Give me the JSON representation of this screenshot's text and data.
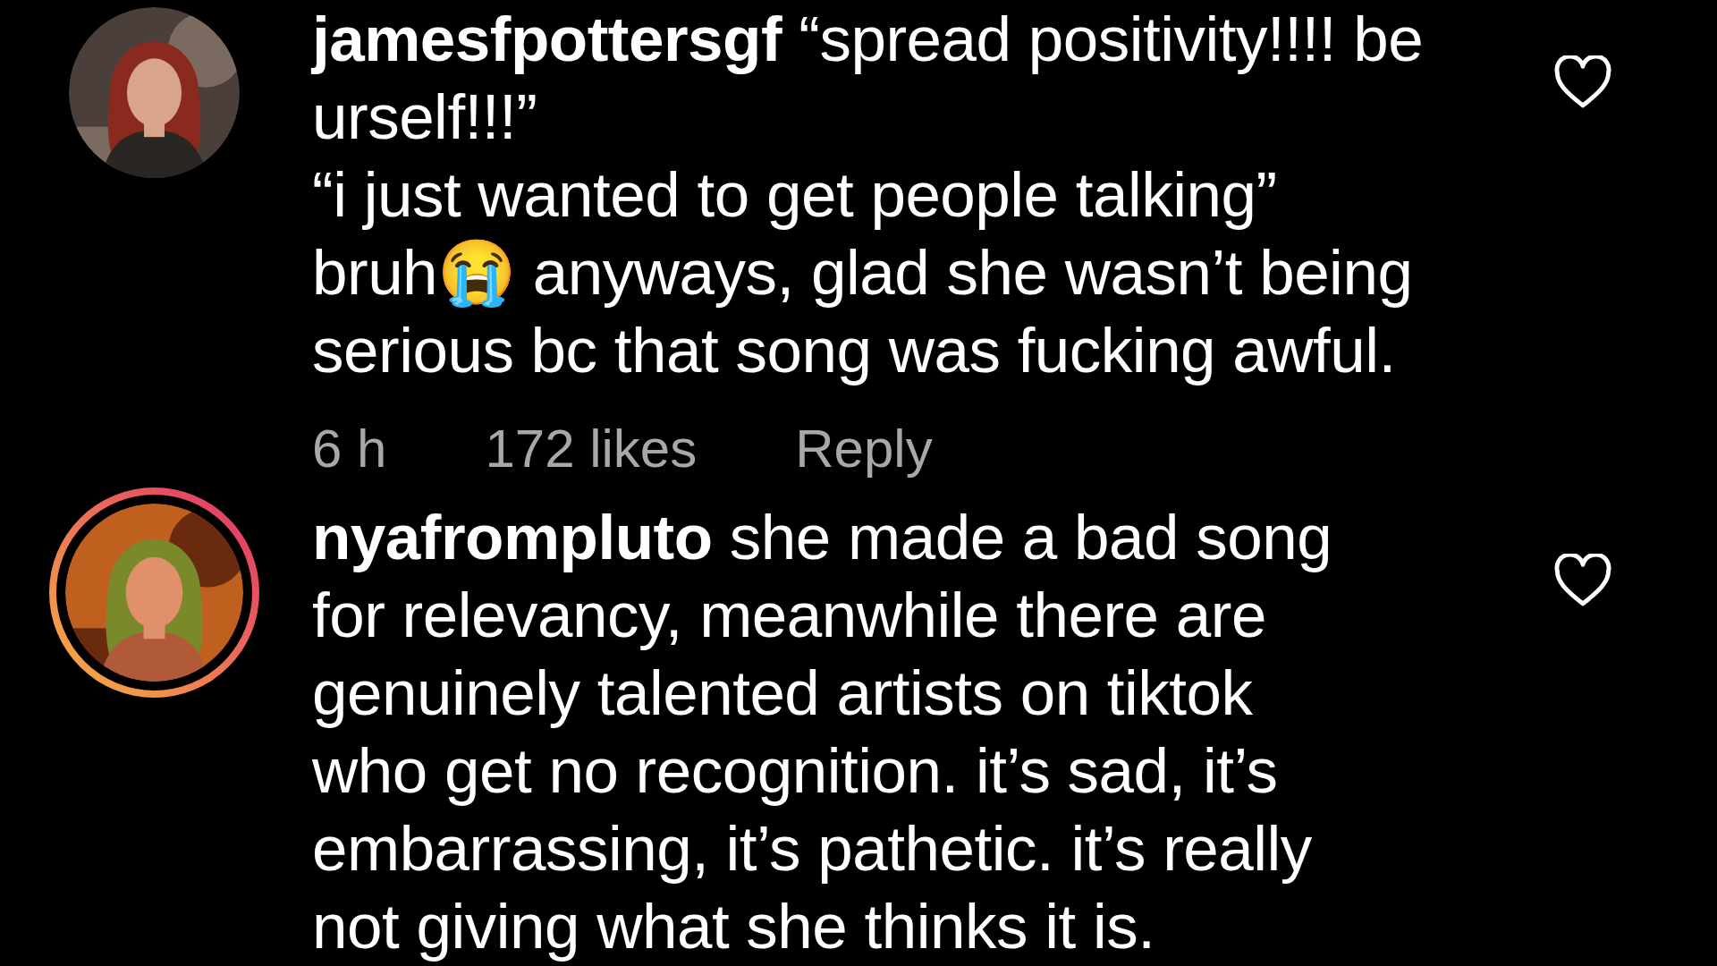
{
  "comments": [
    {
      "username": "jamesfpottersgf",
      "text": "“spread positivity!!!! be\nurself!!!”\n“i just wanted to get people talking”\nbruh😭 anyways, glad she wasn’t being\nserious bc that song was fucking awful.",
      "story_ring": false,
      "liked": false,
      "time": "6 h",
      "likes": "172 likes",
      "reply": "Reply"
    },
    {
      "username": "nyafrompluto",
      "text": "she made a bad song\nfor relevancy, meanwhile there are\ngenuinely talented artists on tiktok\nwho get no recognition. it’s sad, it’s\nembarrassing, it’s pathetic. it’s really\nnot giving what she thinks it is.",
      "story_ring": true,
      "liked": false
    }
  ]
}
